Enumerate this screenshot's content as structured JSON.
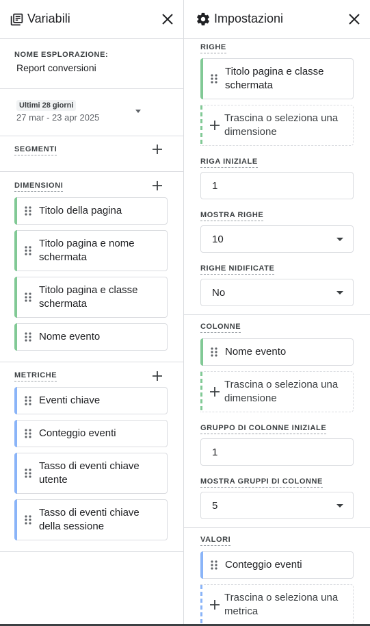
{
  "variables_panel": {
    "title": "Variabili",
    "exploration_name_label": "NOME ESPLORAZIONE:",
    "exploration_name_value": "Report conversioni",
    "date_badge": "Ultimi 28 giorni",
    "date_range": "27 mar - 23 apr 2025",
    "segments_label": "SEGMENTI",
    "dimensions_label": "DIMENSIONI",
    "dimensions": [
      "Titolo della pagina",
      "Titolo pagina e nome schermata",
      "Titolo pagina e classe schermata",
      "Nome evento"
    ],
    "metrics_label": "METRICHE",
    "metrics": [
      "Eventi chiave",
      "Conteggio eventi",
      "Tasso di eventi chiave utente",
      "Tasso di eventi chiave della sessione"
    ]
  },
  "settings_panel": {
    "title": "Impostazioni",
    "rows_label": "RIGHE",
    "rows_chip": "Titolo pagina e classe schermata",
    "rows_drop": "Trascina o seleziona una dimensione",
    "start_row_label": "RIGA INIZIALE",
    "start_row_value": "1",
    "show_rows_label": "MOSTRA RIGHE",
    "show_rows_value": "10",
    "nested_rows_label": "RIGHE NIDIFICATE",
    "nested_rows_value": "No",
    "columns_label": "COLONNE",
    "columns_chip": "Nome evento",
    "columns_drop": "Trascina o seleziona una dimensione",
    "start_col_group_label": "GRUPPO DI COLONNE INIZIALE",
    "start_col_group_value": "1",
    "show_col_groups_label": "MOSTRA GRUPPI DI COLONNE",
    "show_col_groups_value": "5",
    "values_label": "VALORI",
    "values_chip": "Conteggio eventi",
    "values_drop": "Trascina o seleziona una metrica"
  },
  "colors": {
    "dimension_accent": "#81c995",
    "metric_accent": "#8ab4f8",
    "divider": "#dadce0"
  },
  "icons": [
    "variables-list-icon",
    "close-icon",
    "settings-gear-icon",
    "add-icon",
    "drag-handle-icon",
    "dropdown-arrow-icon"
  ]
}
